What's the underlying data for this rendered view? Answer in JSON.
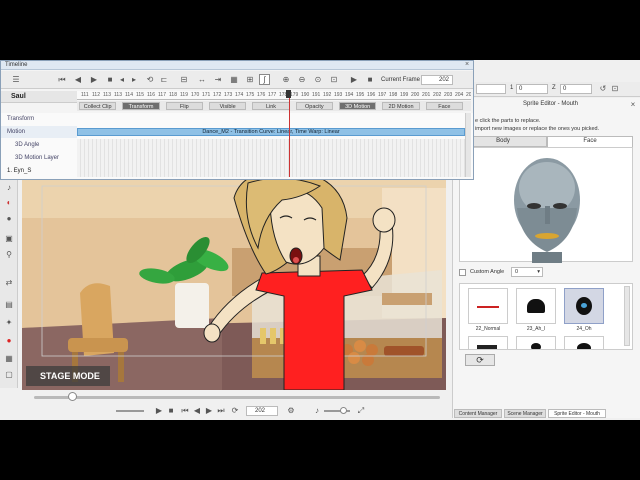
{
  "timeline": {
    "title": "Timeline",
    "current_frame_label": "Current Frame",
    "current_frame_value": "202",
    "track_name": "Saul",
    "track_buttons": [
      "Collect Clip",
      "Transform",
      "Flip",
      "Visible",
      "Link",
      "Opacity",
      "3D Motion",
      "2D Motion",
      "Face"
    ],
    "selected_buttons": [
      "Transform",
      "3D Motion"
    ],
    "rows": [
      "Transform",
      "Motion",
      "3D Angle",
      "3D Motion Layer",
      "1. Eyn_S"
    ],
    "motion_clip_text": "Dance_M2 - Transition Curve: Linear, Time Warp: Linear",
    "ruler_ticks": [
      "111",
      "112",
      "113",
      "113",
      "114",
      "115",
      "116",
      "117",
      "118",
      "119",
      "170",
      "171",
      "172",
      "173",
      "174",
      "175",
      "176",
      "177",
      "178",
      "179",
      "190",
      "191",
      "192",
      "193",
      "194",
      "195",
      "196",
      "197",
      "198",
      "199",
      "200",
      "201",
      "202",
      "203",
      "204",
      "205",
      "206",
      "207",
      "208",
      "209",
      "210",
      "211",
      "212",
      "213",
      "214",
      "215",
      "216",
      "217",
      "218",
      "219",
      "220",
      "221",
      "222",
      "223",
      "224",
      "225",
      "226",
      "227",
      "228",
      "229",
      "230",
      "231",
      "232",
      "233",
      "234",
      "235",
      "236",
      "237",
      "238",
      "239",
      "240"
    ]
  },
  "viewport": {
    "stage_mode_label": "STAGE MODE",
    "frame_value": "202"
  },
  "right_panel": {
    "coord_y_label": "1",
    "coord_z_label": "Z",
    "coord_y_value": "0",
    "coord_z_value": "0",
    "title": "Sprite Editor - Mouth",
    "instr_line1": "e click the parts to replace.",
    "instr_line2": "import new images or replace the ones you picked.",
    "tab_body": "Body",
    "tab_face": "Face",
    "custom_angle_label": "Custom Angle",
    "custom_angle_value": "0",
    "thumbs": [
      {
        "label": "22_Normal"
      },
      {
        "label": "23_Ah_l"
      },
      {
        "label": "24_Oh"
      },
      {
        "label": ""
      },
      {
        "label": ""
      },
      {
        "label": ""
      }
    ],
    "bottom_tabs": [
      "Content Manager",
      "Scene Manager",
      "Sprite Editor - Mouth"
    ]
  },
  "colors": {
    "accent": "#4a90c8",
    "timeline_highlight": "#8fc1e6",
    "playhead": "#cc3333",
    "app_bg": "#f0f0f0",
    "shirt": "#ff2020"
  }
}
